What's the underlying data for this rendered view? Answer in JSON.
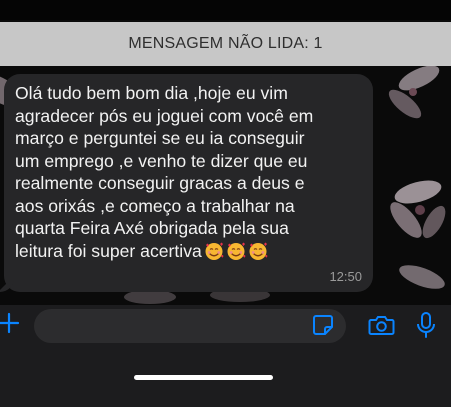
{
  "unread_banner": {
    "text": "MENSAGEM NÃO LIDA: 1"
  },
  "message": {
    "text": "Olá tudo bem bom dia ,hoje eu vim\nagradecer pós eu joguei com você em\nmarço e perguntei se eu ia conseguir\num emprego ,e venho te dizer que eu\nrealmente conseguir gracas a deus e\naos orixás ,e começo a trabalhar na\nquarta Feira Axé obrigada pela sua\nleitura foi super acertiva",
    "emojis": [
      "smiling-face-with-hearts",
      "smiling-face-with-hearts",
      "smiling-face-with-hearts"
    ],
    "time": "12:50"
  },
  "input_bar": {
    "placeholder": "",
    "icons": [
      "plus-icon",
      "sticker-icon",
      "camera-icon",
      "microphone-icon"
    ]
  },
  "colors": {
    "accent": "#0a84ff",
    "bubble": "#262628",
    "banner": "#dcdcdc",
    "background": "#0a0a0a"
  }
}
